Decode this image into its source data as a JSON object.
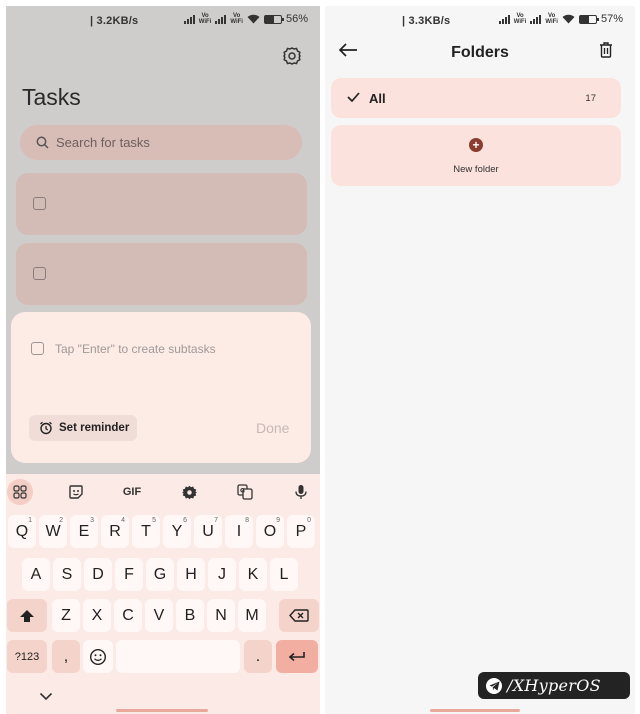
{
  "left_screen": {
    "status": {
      "speed": "3.2KB/s",
      "battery": "56%",
      "battery_level": 0.56,
      "wifi_label": "Vo WiFi"
    },
    "title": "Tasks",
    "search": {
      "placeholder": "Search for tasks"
    },
    "task_items": 2,
    "editor": {
      "placeholder": "Tap \"Enter\" to create subtasks",
      "reminder_label": "Set reminder",
      "done_label": "Done"
    },
    "keyboard": {
      "toolbar": {
        "gif": "GIF"
      },
      "row1": [
        {
          "k": "Q",
          "h": "1"
        },
        {
          "k": "W",
          "h": "2"
        },
        {
          "k": "E",
          "h": "3"
        },
        {
          "k": "R",
          "h": "4"
        },
        {
          "k": "T",
          "h": "5"
        },
        {
          "k": "Y",
          "h": "6"
        },
        {
          "k": "U",
          "h": "7"
        },
        {
          "k": "I",
          "h": "8"
        },
        {
          "k": "O",
          "h": "9"
        },
        {
          "k": "P",
          "h": "0"
        }
      ],
      "row2": [
        "A",
        "S",
        "D",
        "F",
        "G",
        "H",
        "J",
        "K",
        "L"
      ],
      "row3": [
        "Z",
        "X",
        "C",
        "V",
        "B",
        "N",
        "M"
      ],
      "symbols": "?123",
      "comma": ",",
      "period": "."
    }
  },
  "right_screen": {
    "status": {
      "speed": "3.3KB/s",
      "battery": "57%",
      "battery_level": 0.57
    },
    "title": "Folders",
    "folders": [
      {
        "name": "All",
        "count": "17",
        "selected": true
      }
    ],
    "new_folder_label": "New folder"
  },
  "watermark": "/XHyperOS",
  "colors": {
    "accent": "#8a3d31",
    "card": "#fbe2dc",
    "keyboard_bg": "#fbeae5",
    "enter_key": "#f2aea0"
  }
}
